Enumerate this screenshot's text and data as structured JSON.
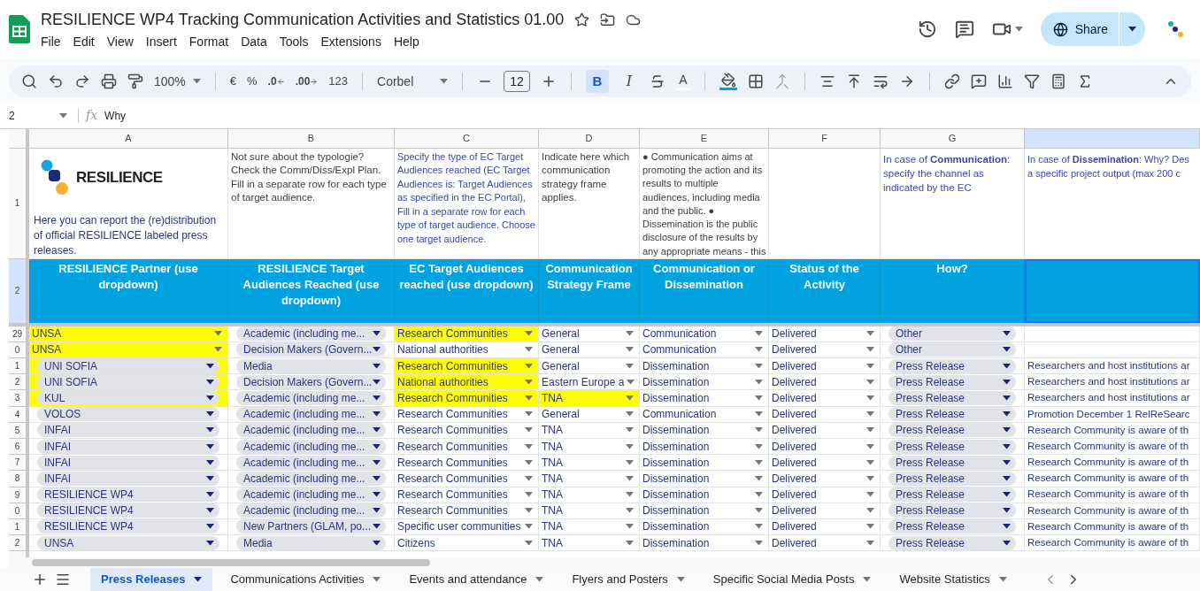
{
  "document": {
    "title": "RESILIENCE WP4 Tracking Communication Activities and Statistics 01.00"
  },
  "menu": [
    "File",
    "Edit",
    "View",
    "Insert",
    "Format",
    "Data",
    "Tools",
    "Extensions",
    "Help"
  ],
  "share_button": "Share",
  "toolbar": {
    "zoom": "100%",
    "currency": "€",
    "percent": "%",
    "decrease_decimals": ".0",
    "increase_decimals": ".00",
    "number_format": "123",
    "font": "Corbel",
    "font_size": "12",
    "bold": {
      "label": "B",
      "selected": true
    },
    "italic": {
      "label": "I",
      "selected": false
    },
    "text_color": "A"
  },
  "formula_bar": {
    "cell_ref": "2",
    "fx": "fx",
    "formula": "Why"
  },
  "columns": [
    {
      "letter": "A",
      "selected": false
    },
    {
      "letter": "B",
      "selected": false
    },
    {
      "letter": "C",
      "selected": false
    },
    {
      "letter": "D",
      "selected": false
    },
    {
      "letter": "E",
      "selected": false
    },
    {
      "letter": "F",
      "selected": false
    },
    {
      "letter": "G",
      "selected": false
    },
    {
      "selected": true
    }
  ],
  "row_1": {
    "number": "1",
    "logo_text": "RESILIENCE",
    "a": "Here you can report the (re)distribution of official RESILIENCE labeled press releases.",
    "b": "Not sure about the typologie? Check the Comm/Diss/Expl Plan. Fill in a separate row for each type of target audience.",
    "c": "Specify the type of EC Target Audiences reached (EC Target Audiences is: Target Audiences as specified in the EC Portal), Fill in a separate row for each type of target audience. Choose one target audience.",
    "d": "Indicate here which communication strategy frame applies.",
    "e_lines": [
      "● Communication aims at",
      "promoting the action and its",
      "results to multiple",
      "audiences, including media",
      "and the public. ●",
      "Dissemination is the public",
      "disclosure of the results by",
      "any appropriate means - this"
    ],
    "g": "In case of **Communication**: specify the channel as indicated by the EC",
    "h_lines": [
      "In case of **Dissemination**: Why? Des",
      "a specific project output (max 200 c"
    ]
  },
  "row_2": {
    "number": "2",
    "headers": [
      "RESILIENCE Partner (use dropdown)",
      "RESILIENCE Target Audiences Reached (use dropdown)",
      "EC Target Audiences reached (use dropdown)",
      "Communication Strategy Frame",
      "Communication or Dissemination",
      "Status of the Activity",
      "How?"
    ],
    "last_cell_selected": true
  },
  "rows": [
    {
      "number": "29",
      "cells": [
        {
          "text": "UNSA",
          "kind": "plain",
          "highlighted": true
        },
        {
          "text": "Academic (including me...",
          "kind": "chip",
          "highlighted": false
        },
        {
          "text": "Research Communities",
          "kind": "plain",
          "highlighted": true
        },
        {
          "text": "General",
          "kind": "plain",
          "highlighted": false
        },
        {
          "text": "Communication",
          "kind": "plain",
          "highlighted": false
        },
        {
          "text": "Delivered",
          "kind": "plain",
          "highlighted": false
        },
        {
          "text": "Other",
          "kind": "chip",
          "highlighted": false
        },
        {
          "kind": "text",
          "highlighted": false
        }
      ]
    },
    {
      "number": "0",
      "cells": [
        {
          "text": "UNSA",
          "kind": "plain",
          "highlighted": true
        },
        {
          "text": "Decision Makers (Govern...",
          "kind": "chip",
          "highlighted": false
        },
        {
          "text": "National authorities",
          "kind": "plain",
          "highlighted": false
        },
        {
          "text": "General",
          "kind": "plain",
          "highlighted": false
        },
        {
          "text": "Communication",
          "kind": "plain",
          "highlighted": false
        },
        {
          "text": "Delivered",
          "kind": "plain",
          "highlighted": false
        },
        {
          "text": "Other",
          "kind": "chip",
          "highlighted": false
        },
        {
          "kind": "text",
          "highlighted": false
        }
      ]
    },
    {
      "number": "1",
      "cells": [
        {
          "text": "UNI SOFIA",
          "kind": "chip",
          "highlighted": true
        },
        {
          "text": "Media",
          "kind": "chip",
          "highlighted": false
        },
        {
          "text": "Research Communities",
          "kind": "plain",
          "highlighted": true
        },
        {
          "text": "General",
          "kind": "plain",
          "highlighted": false
        },
        {
          "text": "Dissemination",
          "kind": "plain",
          "highlighted": false
        },
        {
          "text": "Delivered",
          "kind": "plain",
          "highlighted": false
        },
        {
          "text": "Press Release",
          "kind": "chip",
          "highlighted": false
        },
        {
          "text": "Researchers and host institutions ar",
          "kind": "text",
          "highlighted": false
        }
      ]
    },
    {
      "number": "2",
      "cells": [
        {
          "text": "UNI SOFIA",
          "kind": "chip",
          "highlighted": true
        },
        {
          "text": "Decision Makers (Govern...",
          "kind": "chip",
          "highlighted": false
        },
        {
          "text": "National authorities",
          "kind": "plain",
          "highlighted": true
        },
        {
          "text": "Eastern Europe a",
          "kind": "plain",
          "highlighted": false
        },
        {
          "text": "Dissemination",
          "kind": "plain",
          "highlighted": false
        },
        {
          "text": "Delivered",
          "kind": "plain",
          "highlighted": false
        },
        {
          "text": "Press Release",
          "kind": "chip",
          "highlighted": false
        },
        {
          "text": "Researchers and host institutions ar",
          "kind": "text",
          "highlighted": false
        }
      ]
    },
    {
      "number": "3",
      "cells": [
        {
          "text": "KUL",
          "kind": "chip",
          "highlighted": true
        },
        {
          "text": "Academic (including me...",
          "kind": "chip",
          "highlighted": false
        },
        {
          "text": "Research Communities",
          "kind": "plain",
          "highlighted": true
        },
        {
          "text": "TNA",
          "kind": "plain",
          "highlighted": true
        },
        {
          "text": "Dissemination",
          "kind": "plain",
          "highlighted": false
        },
        {
          "text": "Delivered",
          "kind": "plain",
          "highlighted": false
        },
        {
          "text": "Press Release",
          "kind": "chip",
          "highlighted": false
        },
        {
          "text": "Researchers and host institutions ar",
          "kind": "text",
          "highlighted": false
        }
      ]
    },
    {
      "number": "4",
      "cells": [
        {
          "text": "VOLOS",
          "kind": "chip",
          "highlighted": false
        },
        {
          "text": "Academic (including me...",
          "kind": "chip",
          "highlighted": false
        },
        {
          "text": "Research Communities",
          "kind": "plain",
          "highlighted": false
        },
        {
          "text": "General",
          "kind": "plain",
          "highlighted": false
        },
        {
          "text": "Communication",
          "kind": "plain",
          "highlighted": false
        },
        {
          "text": "Delivered",
          "kind": "plain",
          "highlighted": false
        },
        {
          "text": "Press Release",
          "kind": "chip",
          "highlighted": false
        },
        {
          "text": "Promotion December 1 RelReSearc",
          "kind": "text",
          "highlighted": false
        }
      ]
    },
    {
      "number": "5",
      "cells": [
        {
          "text": "INFAI",
          "kind": "chip",
          "highlighted": false
        },
        {
          "text": "Academic (including me...",
          "kind": "chip",
          "highlighted": false
        },
        {
          "text": "Research Communities",
          "kind": "plain",
          "highlighted": false
        },
        {
          "text": "TNA",
          "kind": "plain",
          "highlighted": false
        },
        {
          "text": "Dissemination",
          "kind": "plain",
          "highlighted": false
        },
        {
          "text": "Delivered",
          "kind": "plain",
          "highlighted": false
        },
        {
          "text": "Press Release",
          "kind": "chip",
          "highlighted": false
        },
        {
          "text": "Research Community is aware of th",
          "kind": "text",
          "highlighted": false
        }
      ]
    },
    {
      "number": "6",
      "cells": [
        {
          "text": "INFAI",
          "kind": "chip",
          "highlighted": false
        },
        {
          "text": "Academic (including me...",
          "kind": "chip",
          "highlighted": false
        },
        {
          "text": "Research Communities",
          "kind": "plain",
          "highlighted": false
        },
        {
          "text": "TNA",
          "kind": "plain",
          "highlighted": false
        },
        {
          "text": "Dissemination",
          "kind": "plain",
          "highlighted": false
        },
        {
          "text": "Delivered",
          "kind": "plain",
          "highlighted": false
        },
        {
          "text": "Press Release",
          "kind": "chip",
          "highlighted": false
        },
        {
          "text": "Research Community is aware of th",
          "kind": "text",
          "highlighted": false
        }
      ]
    },
    {
      "number": "7",
      "cells": [
        {
          "text": "INFAI",
          "kind": "chip",
          "highlighted": false
        },
        {
          "text": "Academic (including me...",
          "kind": "chip",
          "highlighted": false
        },
        {
          "text": "Research Communities",
          "kind": "plain",
          "highlighted": false
        },
        {
          "text": "TNA",
          "kind": "plain",
          "highlighted": false
        },
        {
          "text": "Dissemination",
          "kind": "plain",
          "highlighted": false
        },
        {
          "text": "Delivered",
          "kind": "plain",
          "highlighted": false
        },
        {
          "text": "Press Release",
          "kind": "chip",
          "highlighted": false
        },
        {
          "text": "Research Community is aware of th",
          "kind": "text",
          "highlighted": false
        }
      ]
    },
    {
      "number": "8",
      "cells": [
        {
          "text": "INFAI",
          "kind": "chip",
          "highlighted": false
        },
        {
          "text": "Academic (including me...",
          "kind": "chip",
          "highlighted": false
        },
        {
          "text": "Research Communities",
          "kind": "plain",
          "highlighted": false
        },
        {
          "text": "TNA",
          "kind": "plain",
          "highlighted": false
        },
        {
          "text": "Dissemination",
          "kind": "plain",
          "highlighted": false
        },
        {
          "text": "Delivered",
          "kind": "plain",
          "highlighted": false
        },
        {
          "text": "Press Release",
          "kind": "chip",
          "highlighted": false
        },
        {
          "text": "Research Community is aware of th",
          "kind": "text",
          "highlighted": false
        }
      ]
    },
    {
      "number": "9",
      "cells": [
        {
          "text": "RESILIENCE WP4",
          "kind": "chip",
          "highlighted": false
        },
        {
          "text": "Academic (including me...",
          "kind": "chip",
          "highlighted": false
        },
        {
          "text": "Research Communities",
          "kind": "plain",
          "highlighted": false
        },
        {
          "text": "TNA",
          "kind": "plain",
          "highlighted": false
        },
        {
          "text": "Dissemination",
          "kind": "plain",
          "highlighted": false
        },
        {
          "text": "Delivered",
          "kind": "plain",
          "highlighted": false
        },
        {
          "text": "Press Release",
          "kind": "chip",
          "highlighted": false
        },
        {
          "text": "Research Community is aware of th",
          "kind": "text",
          "highlighted": false
        }
      ]
    },
    {
      "number": "0",
      "cells": [
        {
          "text": "RESILIENCE WP4",
          "kind": "chip",
          "highlighted": false
        },
        {
          "text": "Academic (including me...",
          "kind": "chip",
          "highlighted": false
        },
        {
          "text": "Research Communities",
          "kind": "plain",
          "highlighted": false
        },
        {
          "text": "TNA",
          "kind": "plain",
          "highlighted": false
        },
        {
          "text": "Dissemination",
          "kind": "plain",
          "highlighted": false
        },
        {
          "text": "Delivered",
          "kind": "plain",
          "highlighted": false
        },
        {
          "text": "Press Release",
          "kind": "chip",
          "highlighted": false
        },
        {
          "text": "Research Community is aware of th",
          "kind": "text",
          "highlighted": false
        }
      ]
    },
    {
      "number": "1",
      "cells": [
        {
          "text": "RESILIENCE WP4",
          "kind": "chip",
          "highlighted": false
        },
        {
          "text": "New Partners (GLAM, po...",
          "kind": "chip",
          "highlighted": false
        },
        {
          "text": "Specific user communities",
          "kind": "plain",
          "highlighted": false
        },
        {
          "text": "TNA",
          "kind": "plain",
          "highlighted": false
        },
        {
          "text": "Dissemination",
          "kind": "plain",
          "highlighted": false
        },
        {
          "text": "Delivered",
          "kind": "plain",
          "highlighted": false
        },
        {
          "text": "Press Release",
          "kind": "chip",
          "highlighted": false
        },
        {
          "text": "Research Community is aware of th",
          "kind": "text",
          "highlighted": false
        }
      ]
    },
    {
      "number": "2",
      "cells": [
        {
          "text": "UNSA",
          "kind": "chip",
          "highlighted": false
        },
        {
          "text": "Media",
          "kind": "chip",
          "highlighted": false
        },
        {
          "text": "Citizens",
          "kind": "plain",
          "highlighted": false
        },
        {
          "text": "TNA",
          "kind": "plain",
          "highlighted": false
        },
        {
          "text": "Dissemination",
          "kind": "plain",
          "highlighted": false
        },
        {
          "text": "Delivered",
          "kind": "plain",
          "highlighted": false
        },
        {
          "text": "Press Release",
          "kind": "chip",
          "highlighted": false
        },
        {
          "text": "Research Community is aware of th",
          "kind": "text",
          "highlighted": false
        }
      ]
    }
  ],
  "sheet_tabs": [
    {
      "label": "Press Releases",
      "selected": true
    },
    {
      "label": "Communications Activities",
      "selected": false
    },
    {
      "label": "Events and attendance",
      "selected": false
    },
    {
      "label": "Flyers and Posters",
      "selected": false
    },
    {
      "label": "Specific Social Media Posts",
      "selected": false
    },
    {
      "label": "Website Statistics",
      "selected": false
    }
  ]
}
